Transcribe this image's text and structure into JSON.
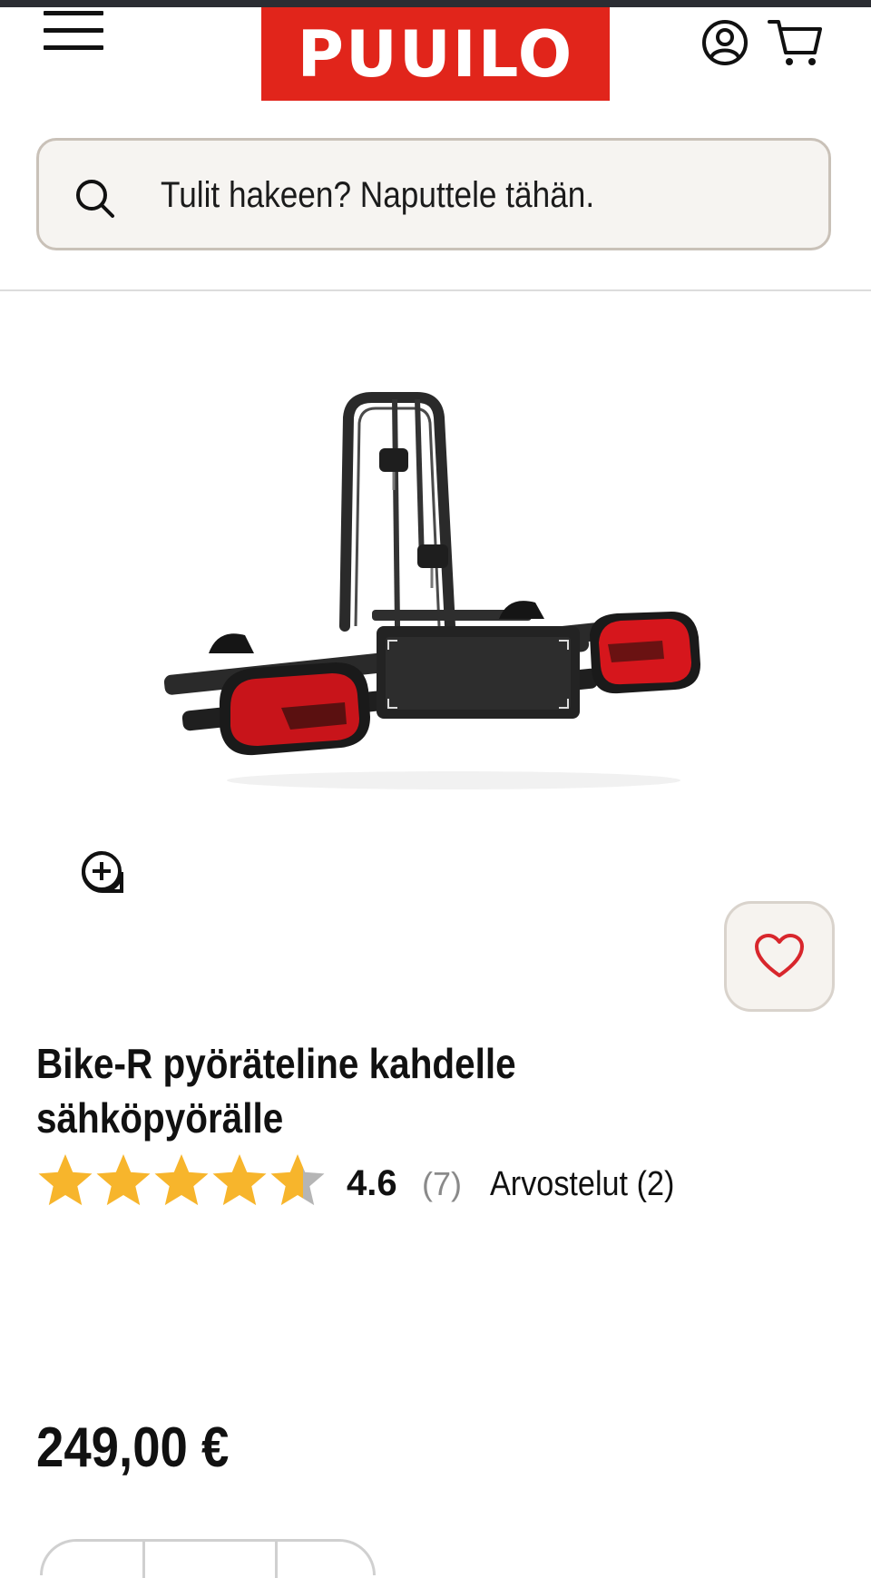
{
  "header": {
    "logo_text": "PUUILO",
    "brand_color": "#e1251b",
    "menu_icon": "hamburger-menu-icon",
    "account_icon": "user-account-icon",
    "cart_icon": "shopping-cart-icon"
  },
  "search": {
    "placeholder": "Tulit hakeen? Naputtele tähän.",
    "icon": "search-icon"
  },
  "product": {
    "image_alt": "bike-rack-image",
    "title": "Bike-R pyöräteline kahdelle sähköpyörälle",
    "rating_value": "4.6",
    "rating_fraction": 0.92,
    "rating_count": "(7)",
    "reviews_label": "Arvostelut (2)",
    "price": "249,00 €",
    "star_color": "#f7b52c",
    "empty_star_color": "#b5b5b5",
    "favorite_icon": "heart-icon",
    "zoom_icon": "zoom-in-icon"
  }
}
